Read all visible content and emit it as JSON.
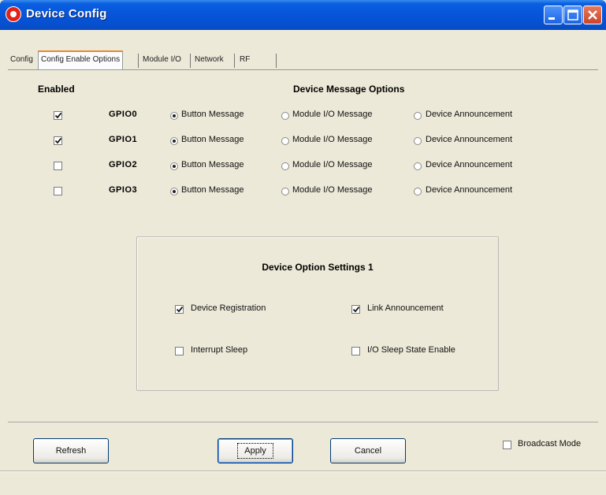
{
  "window": {
    "title": "Device Config"
  },
  "tabs": [
    {
      "label": "Config",
      "active": false
    },
    {
      "label": "Config Enable Options",
      "active": true
    },
    {
      "label": "Module I/O",
      "active": false
    },
    {
      "label": "Network",
      "active": false
    },
    {
      "label": "RF",
      "active": false
    }
  ],
  "headers": {
    "enabled": "Enabled",
    "device_message_options": "Device Message Options"
  },
  "message_options": [
    "Button Message",
    "Module I/O Message",
    "Device Announcement"
  ],
  "gpios": [
    {
      "name": "GPIO0",
      "enabled": true,
      "selected": "Button Message"
    },
    {
      "name": "GPIO1",
      "enabled": true,
      "selected": "Button Message"
    },
    {
      "name": "GPIO2",
      "enabled": false,
      "selected": "Button Message"
    },
    {
      "name": "GPIO3",
      "enabled": false,
      "selected": "Button Message"
    }
  ],
  "settings_group": {
    "title": "Device Option Settings 1",
    "options": [
      {
        "label": "Device Registration",
        "checked": true
      },
      {
        "label": "Link Announcement",
        "checked": true
      },
      {
        "label": "Interrupt Sleep",
        "checked": false
      },
      {
        "label": "I/O Sleep State Enable",
        "checked": false
      }
    ]
  },
  "buttons": {
    "refresh": "Refresh",
    "apply": "Apply",
    "cancel": "Cancel"
  },
  "broadcast_mode": {
    "label": "Broadcast Mode",
    "checked": false
  },
  "colors": {
    "titlebar": "#0754d8",
    "window_bg": "#ece9d8",
    "active_tab_accent": "#e68b2c"
  }
}
